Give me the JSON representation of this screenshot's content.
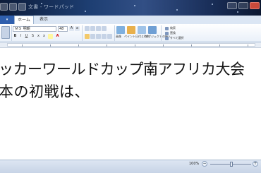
{
  "window": {
    "title": "文書 - ワードパッド"
  },
  "ribbon": {
    "tabs": [
      {
        "label": "ホーム"
      },
      {
        "label": "表示"
      }
    ],
    "font_family": "ＭＳ 明朝",
    "font_size": "48",
    "insert": {
      "picture_label": "画像",
      "paint_label": "ペイント",
      "datetime_label": "日付と時刻",
      "object_label": "オブジェクトの挿入"
    },
    "editing": {
      "find_label": "検索",
      "replace_label": "置換",
      "selectall_label": "すべて選択"
    }
  },
  "document": {
    "line1": "ッカーワールドカップ南アフリカ大会",
    "line2": "本の初戦は、"
  },
  "status": {
    "zoom": "100%"
  },
  "colors": {
    "accent": "#2f5fae",
    "ribbon_bg": "#e9f0f9",
    "text": "#111111"
  }
}
